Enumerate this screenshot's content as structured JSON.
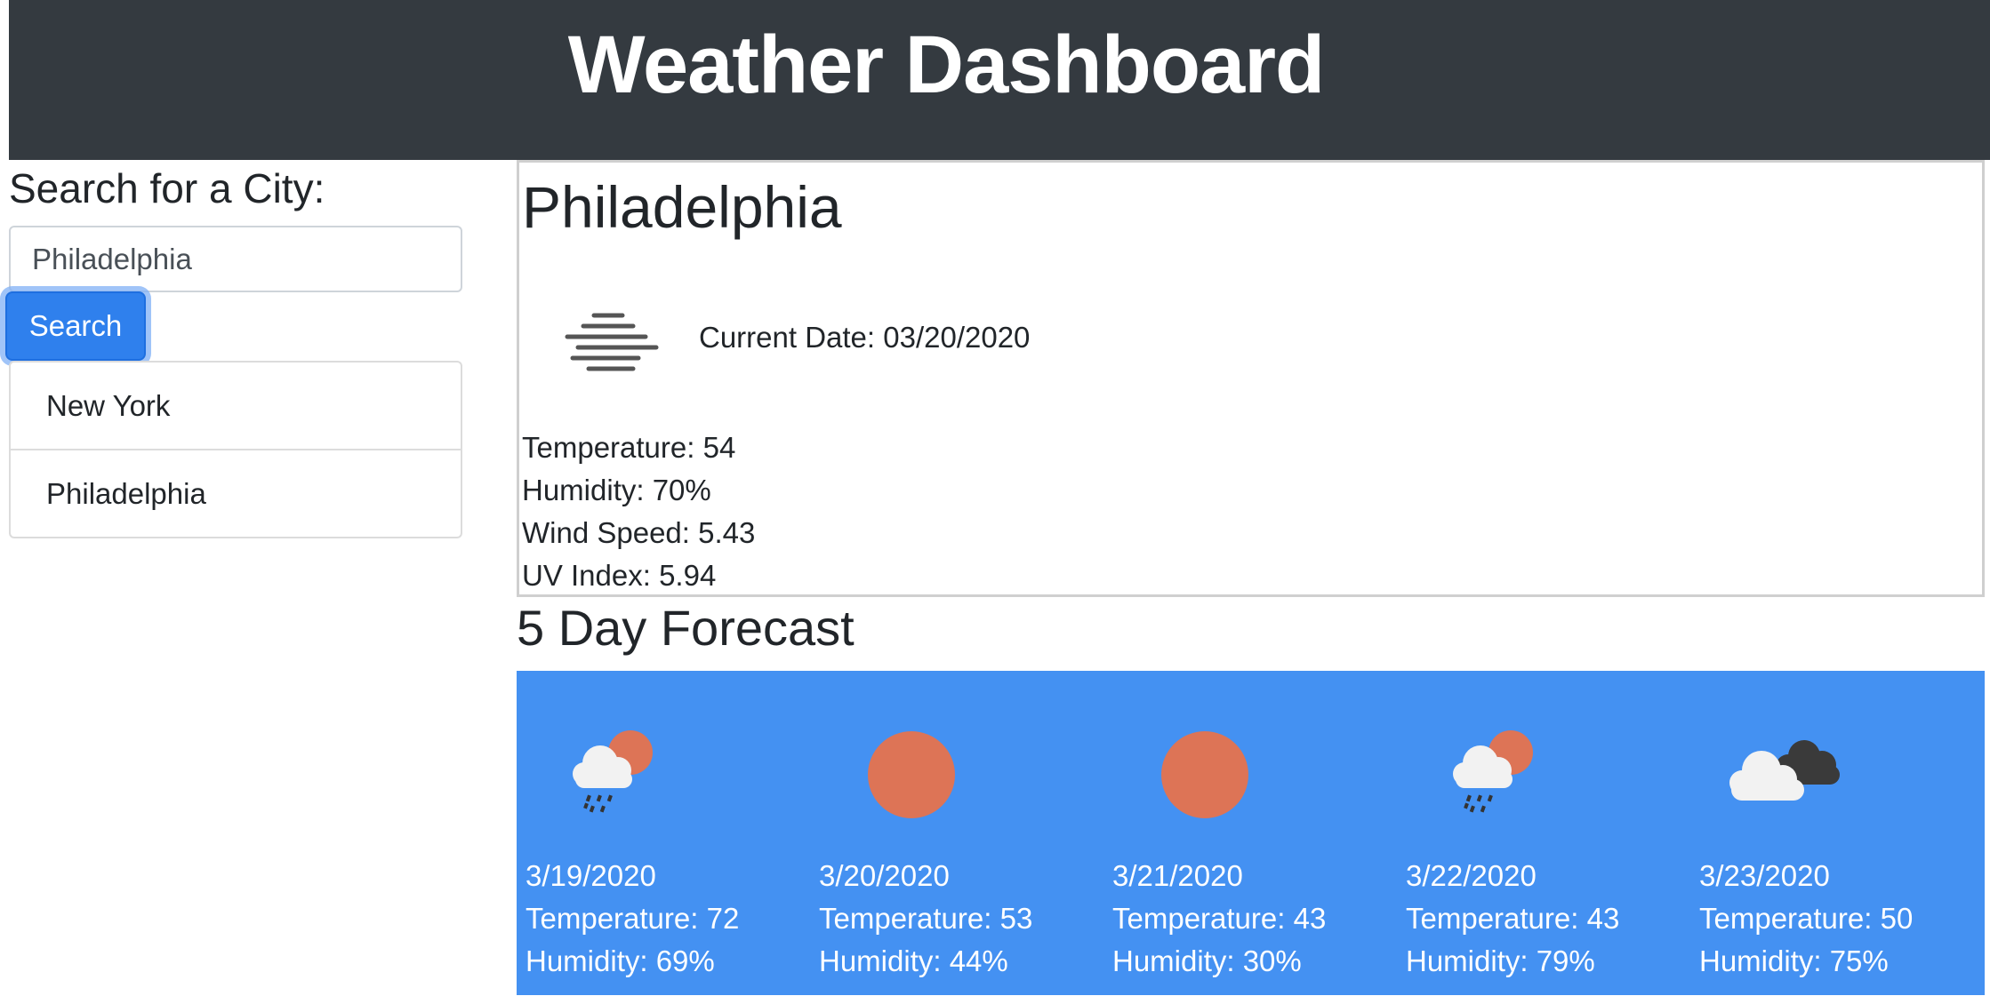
{
  "header": {
    "title": "Weather Dashboard"
  },
  "sidebar": {
    "title": "Search for a City:",
    "search_value": "Philadelphia",
    "search_button_label": "Search",
    "history": [
      {
        "label": "New York"
      },
      {
        "label": "Philadelphia"
      }
    ]
  },
  "current": {
    "city": "Philadelphia",
    "icon": "mist-icon",
    "date_label": "Current Date: 03/20/2020",
    "temperature_label": "Temperature: 54",
    "humidity_label": "Humidity: 70%",
    "wind_label": "Wind Speed: 5.43",
    "uv_label": "UV Index: 5.94"
  },
  "forecast": {
    "title": "5 Day Forecast",
    "days": [
      {
        "date": "3/19/2020",
        "temperature": "Temperature: 72",
        "humidity": "Humidity: 69%",
        "icon": "rain-sun-icon"
      },
      {
        "date": "3/20/2020",
        "temperature": "Temperature: 53",
        "humidity": "Humidity: 44%",
        "icon": "sun-icon"
      },
      {
        "date": "3/21/2020",
        "temperature": "Temperature: 43",
        "humidity": "Humidity: 30%",
        "icon": "sun-icon"
      },
      {
        "date": "3/22/2020",
        "temperature": "Temperature: 43",
        "humidity": "Humidity: 79%",
        "icon": "rain-sun-icon"
      },
      {
        "date": "3/23/2020",
        "temperature": "Temperature: 50",
        "humidity": "Humidity: 75%",
        "icon": "clouds-icon"
      }
    ]
  },
  "colors": {
    "header_bg": "#343a40",
    "accent_button": "#2f80ed",
    "forecast_bg": "#4491f2",
    "sun": "#dd7456",
    "cloud": "#f2f2f2",
    "dark_cloud": "#3a3a3a"
  }
}
